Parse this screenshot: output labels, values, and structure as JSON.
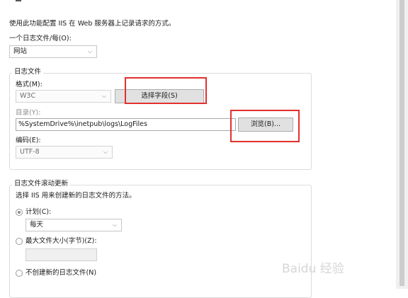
{
  "description": "使用此功能配置 IIS 在 Web 服务器上记录请求的方式。",
  "per_log_file": {
    "label": "一个日志文件/每(O):",
    "value": "网站"
  },
  "log_file_group": {
    "title": "日志文件",
    "format_label": "格式(M):",
    "format_value": "W3C",
    "select_fields_button": "选择字段(S)",
    "directory_label": "目录(Y):",
    "directory_value": "%SystemDrive%\\inetpub\\logs\\LogFiles",
    "browse_button": "浏览(B)...",
    "encoding_label": "编码(E):",
    "encoding_value": "UTF-8"
  },
  "rollover_group": {
    "title": "日志文件滚动更新",
    "description": "选择 IIS 用来创建新的日志文件的方法。",
    "schedule_radio_label": "计划(C):",
    "schedule_value": "每天",
    "max_size_radio_label": "最大文件大小(字节)(Z):",
    "max_size_value": "",
    "no_new_file_radio_label": "不创建新的日志文件(N)"
  },
  "watermark": "Baidu 经验",
  "colors": {
    "highlight_box": "#e2302d",
    "group_border": "#dcdcdc",
    "button_bg": "#e1e1e1"
  }
}
